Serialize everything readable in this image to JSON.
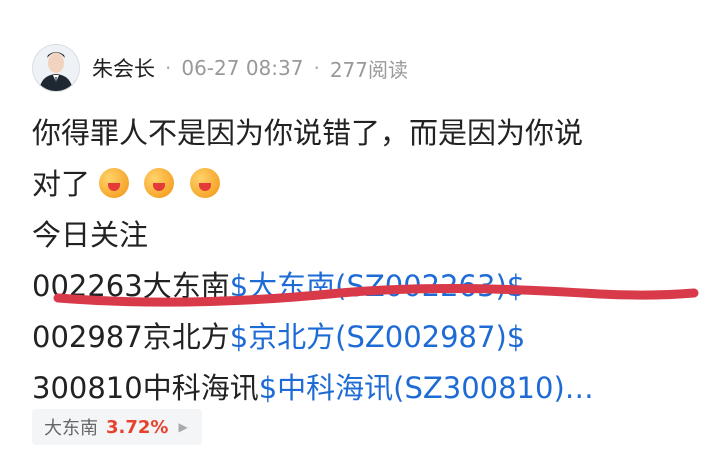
{
  "post": {
    "author": "朱会长",
    "date": "06-27 08:37",
    "reads": "277阅读"
  },
  "body": {
    "line1": "你得罪人不是因为你说错了，而是因为你说",
    "line2_text": "对了",
    "line2_emojis": [
      "watermelon-face-emoji",
      "watermelon-face-emoji",
      "watermelon-face-emoji"
    ],
    "line3": "今日关注",
    "stocks": [
      {
        "code_name": "002263大东南",
        "link": "$大东南(SZ002263)$"
      },
      {
        "code_name": "002987京北方",
        "link": "$京北方(SZ002987)$"
      },
      {
        "code_name": "300810中科海讯",
        "link": "$中科海讯(SZ300810)…"
      }
    ]
  },
  "stock_chip": {
    "name": "大东南",
    "change": "3.72%"
  },
  "colors": {
    "link": "#1e6bd6",
    "up": "#e5432e",
    "annotation_stroke": "#d83a4a"
  }
}
